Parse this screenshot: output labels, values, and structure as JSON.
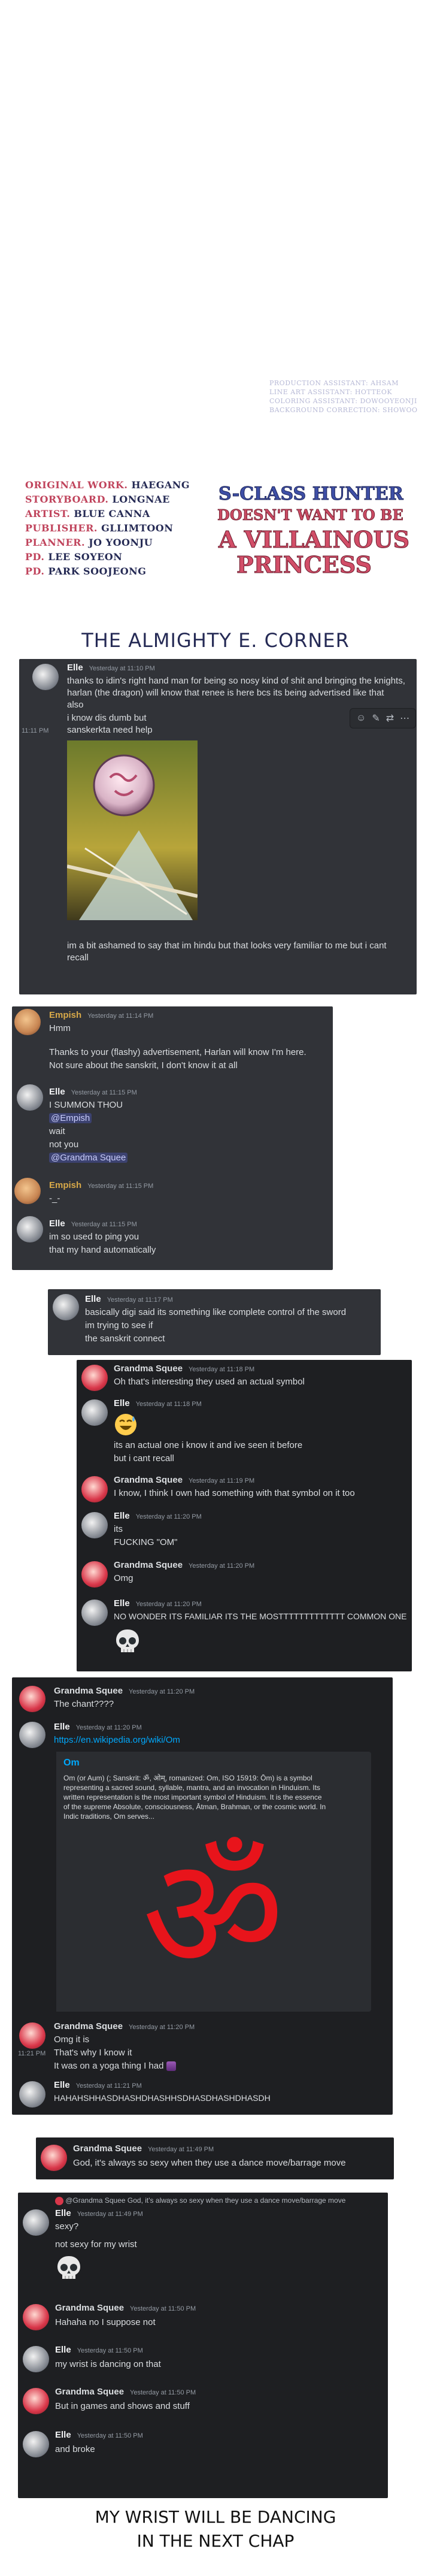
{
  "credits": {
    "right_lines": [
      "PRODUCTION ASSISTANT: AHSAM",
      "LINE ART ASSISTANT: HOTTEOK",
      "COLORING ASSISTANT: DOWOOYEONJI",
      "BACKGROUND CORRECTION: SHOWOO"
    ],
    "left": [
      {
        "k": "ORIGINAL WORK.",
        "v": "HAEGANG"
      },
      {
        "k": "STORYBOARD.",
        "v": "LONGNAE"
      },
      {
        "k": "ARTIST.",
        "v": "BLUE CANNA"
      },
      {
        "k": "PUBLISHER.",
        "v": "GLLIMTOON"
      },
      {
        "k": "PLANNER.",
        "v": "JO YOONJU"
      },
      {
        "k": "PD.",
        "v": "LEE SOYEON"
      },
      {
        "k": "PD.",
        "v": "PARK SOOJEONG"
      }
    ],
    "logo_line1": "S-CLASS HUNTER",
    "logo_line2": "DOESN'T WANT TO BE",
    "logo_line3": "A VILLAINOUS",
    "logo_line4": "PRINCESS"
  },
  "section_title": "THE ALMIGHTY E. CORNER",
  "colors": {
    "discord_bg": "#313338",
    "discord_dark": "#1e1f22",
    "accent": "#5865f2",
    "username": "#f2f3f5",
    "om_red": "#e8141b"
  },
  "panel1": {
    "user": "Elle",
    "ts": "Yesterday at 11:10 PM",
    "lines": [
      "thanks to idin's right hand man for being so nosy kind of shit and bringing the knights,",
      "harlan (the dragon) will know that renee is here bcs its being advertised like that",
      "also",
      "i know dis dumb but",
      "sanskerkta need help"
    ],
    "side_ts": "11:11 PM",
    "after": [
      "im a bit ashamed to say that im hindu but that looks very familiar to me but i cant",
      "recall"
    ]
  },
  "panel2": {
    "m1": {
      "user": "Empish",
      "ts": "Yesterday at 11:14 PM",
      "lines": [
        "Hmm",
        "",
        "Thanks to your (flashy) advertisement, Harlan will know I'm here.",
        "Not sure about the sanskrit, I don't know it at all"
      ]
    },
    "m2": {
      "user": "Elle",
      "ts": "Yesterday at 11:15 PM",
      "lines": [
        "I SUMMON THOU",
        "@Empish",
        "wait",
        "not you",
        "@Grandma Squee"
      ]
    },
    "m3": {
      "user": "Empish",
      "ts": "Yesterday at 11:15 PM",
      "lines": [
        "-_-"
      ]
    },
    "m4": {
      "user": "Elle",
      "ts": "Yesterday at 11:15 PM",
      "lines": [
        "im so used to ping you",
        "that my hand automatically"
      ]
    }
  },
  "panel3": {
    "user": "Elle",
    "ts": "Yesterday at 11:17 PM",
    "lines": [
      "basically digi said its something like complete control of the sword",
      "im trying to see if",
      "the sanskrit connect"
    ]
  },
  "panel4": {
    "m1": {
      "user": "Grandma Squee",
      "ts": "Yesterday at 11:18 PM",
      "lines": [
        "Oh that's interesting they used an actual symbol"
      ]
    },
    "m2": {
      "user": "Elle",
      "ts": "Yesterday at 11:18 PM",
      "lines": [
        "its an actual one i know it and ive seen it before",
        "but i cant recall"
      ]
    },
    "m3": {
      "user": "Grandma Squee",
      "ts": "Yesterday at 11:19 PM",
      "lines": [
        "I know, I think I own had something with that symbol on it too"
      ]
    },
    "m4": {
      "user": "Elle",
      "ts": "Yesterday at 11:20 PM",
      "lines": [
        "its",
        "FUCKING \"OM\""
      ]
    },
    "m5": {
      "user": "Grandma Squee",
      "ts": "Yesterday at 11:20 PM",
      "lines": [
        "Omg"
      ]
    },
    "m6": {
      "user": "Elle",
      "ts": "Yesterday at 11:20 PM",
      "lines": [
        "NO WONDER ITS FAMILIAR ITS THE MOSTTTTTTTTTTTTT COMMON ONE"
      ]
    }
  },
  "panel5": {
    "m1": {
      "user": "Grandma Squee",
      "ts": "Yesterday at 11:20 PM",
      "lines": [
        "The chant????"
      ]
    },
    "m2": {
      "user": "Elle",
      "ts": "Yesterday at 11:20 PM",
      "link": "https://en.wikipedia.org/wiki/Om"
    },
    "embed": {
      "title": "Om",
      "text": [
        "Om (or Aum) (; Sanskrit: ॐ, ओम्, romanized: Om, ISO 15919: Ōm) is a symbol",
        "representing a sacred sound, syllable, mantra, and an invocation in Hinduism. Its",
        "written representation is the most important symbol of Hinduism. It is the essence",
        "of the supreme Absolute, consciousness, Ātman, Brahman, or the cosmic world. In",
        "Indic traditions, Om serves..."
      ],
      "symbol": "ॐ"
    },
    "m3": {
      "user": "Grandma Squee",
      "ts": "Yesterday at 11:20 PM",
      "lines": [
        "Omg it is",
        "That's why I know it",
        "It was on a yoga thing I had"
      ]
    },
    "side_ts": "11:21 PM",
    "m4": {
      "user": "Elle",
      "ts": "Yesterday at 11:21 PM",
      "lines": [
        "HAHAHSHHASDHASHDHASHHSDHASDHASHDHASDH"
      ]
    }
  },
  "panel6": {
    "user": "Grandma Squee",
    "ts": "Yesterday at 11:49 PM",
    "lines": [
      "God, it's always so sexy when they use a dance move/barrage move"
    ]
  },
  "panel7": {
    "reply": "@Grandma Squee God, it's always so sexy when they use a dance move/barrage move",
    "m1": {
      "user": "Elle",
      "ts": "Yesterday at 11:49 PM",
      "lines": [
        "sexy?",
        "not sexy for my wrist"
      ]
    },
    "m2": {
      "user": "Grandma Squee",
      "ts": "Yesterday at 11:50 PM",
      "lines": [
        "Hahaha no I suppose not"
      ]
    },
    "m3": {
      "user": "Elle",
      "ts": "Yesterday at 11:50 PM",
      "lines": [
        "my wrist is dancing on that"
      ]
    },
    "m4": {
      "user": "Grandma Squee",
      "ts": "Yesterday at 11:50 PM",
      "lines": [
        "But in games and shows and stuff"
      ]
    },
    "m5": {
      "user": "Elle",
      "ts": "Yesterday at 11:50 PM",
      "lines": [
        "and broke"
      ]
    }
  },
  "final_caption": [
    "MY WRIST WILL BE DANCING",
    "IN THE NEXT CHAP"
  ]
}
